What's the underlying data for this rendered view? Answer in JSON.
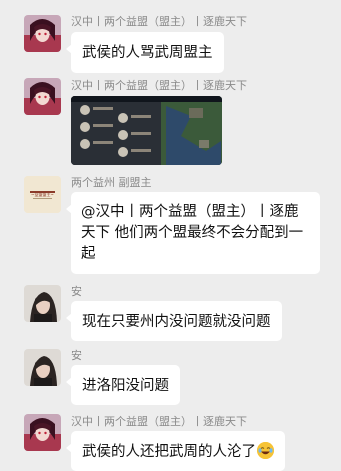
{
  "messages": [
    {
      "sender": "汉中丨两个益盟（盟主）丨逐鹿天下",
      "text": "武侯的人骂武周盟主"
    },
    {
      "sender": "汉中丨两个益盟（盟主）丨逐鹿天下",
      "image": "game-screenshot"
    },
    {
      "sender": "两个益州 副盟主",
      "avatar_text": "~益盟盟主~",
      "text": "@汉中丨两个益盟（盟主）丨逐鹿天下  他们两个盟最终不会分配到一起"
    },
    {
      "sender": "安",
      "text": "现在只要州内没问题就没问题"
    },
    {
      "sender": "安",
      "text": "进洛阳没问题"
    },
    {
      "sender": "汉中丨两个益盟（盟主）丨逐鹿天下",
      "text": "武侯的人还把武周的人沦了",
      "emoji": "laughing-with-tears-emoji"
    }
  ],
  "colors": {
    "background": "#ededed",
    "bubble": "#ffffff",
    "sender_text": "#8a8a8a"
  }
}
